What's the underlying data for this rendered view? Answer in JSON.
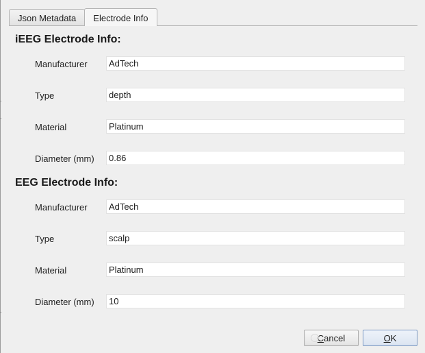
{
  "tabs": [
    {
      "label": "Json Metadata",
      "active": false
    },
    {
      "label": "Electrode Info",
      "active": true
    }
  ],
  "ieeg": {
    "title": "iEEG Electrode Info:",
    "fields": [
      {
        "label": "Manufacturer",
        "value": "AdTech"
      },
      {
        "label": "Type",
        "value": "depth"
      },
      {
        "label": "Material",
        "value": "Platinum"
      },
      {
        "label": "Diameter (mm)",
        "value": "0.86"
      }
    ]
  },
  "eeg": {
    "title": "EEG Electrode Info:",
    "fields": [
      {
        "label": "Manufacturer",
        "value": "AdTech"
      },
      {
        "label": "Type",
        "value": "scalp"
      },
      {
        "label": "Material",
        "value": "Platinum"
      },
      {
        "label": "Diameter (mm)",
        "value": "10"
      }
    ]
  },
  "buttons": {
    "cancel": {
      "mnemonic": "C",
      "rest": "ancel",
      "icon": "cancel-icon"
    },
    "ok": {
      "mnemonic": "O",
      "rest": "K"
    }
  }
}
